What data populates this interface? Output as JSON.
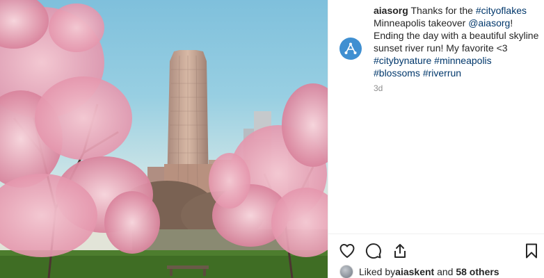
{
  "post": {
    "username": "aiasorg",
    "caption_parts": [
      {
        "text": "Thanks for the ",
        "tag": false
      },
      {
        "text": "#cityoflakes",
        "tag": true
      },
      {
        "text": " Minneapolis takeover ",
        "tag": false
      },
      {
        "text": "@aiasorg",
        "tag": true
      },
      {
        "text": "! Ending the day with a beautiful skyline sunset river run! My favorite <3 ",
        "tag": false
      },
      {
        "text": "#citybynature",
        "tag": true
      },
      {
        "text": " ",
        "tag": false
      },
      {
        "text": "#minneapolis",
        "tag": true
      },
      {
        "text": " ",
        "tag": false
      },
      {
        "text": "#blossoms",
        "tag": true
      },
      {
        "text": " ",
        "tag": false
      },
      {
        "text": "#riverrun",
        "tag": true
      }
    ],
    "timestamp": "3d"
  },
  "likes": {
    "prefix": "Liked by ",
    "user": "aiaskent",
    "middle": " and ",
    "others": "58 others"
  },
  "icons": {
    "avatar": "aia-logo-icon",
    "like": "heart-icon",
    "comment": "comment-icon",
    "share": "share-icon",
    "save": "bookmark-icon"
  },
  "colors": {
    "hashtag": "#00376b",
    "avatar_bg": "#3f8fd1",
    "muted": "#8e8e8e"
  }
}
